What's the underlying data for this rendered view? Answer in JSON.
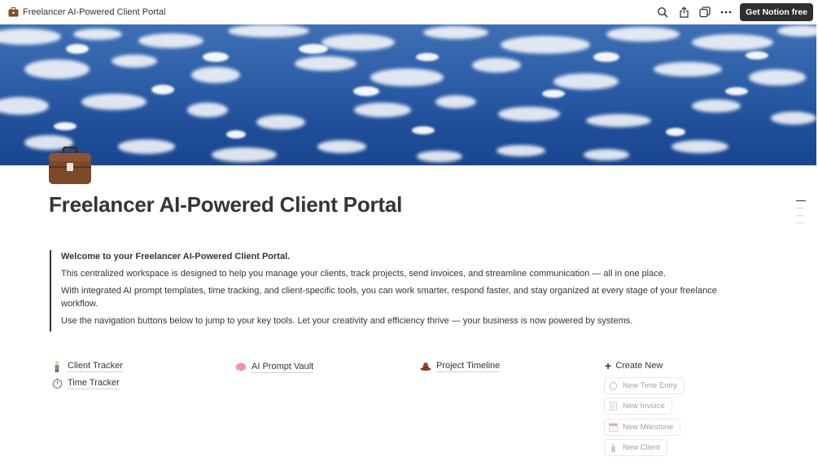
{
  "topbar": {
    "title": "Freelancer AI-Powered Client Portal",
    "icons": [
      "search-icon",
      "share-icon",
      "duplicate-icon",
      "more-icon"
    ],
    "cta_label": "Get Notion free"
  },
  "page": {
    "icon": "briefcase-icon",
    "title": "Freelancer AI-Powered Client Portal"
  },
  "callout": {
    "heading": "Welcome to your Freelancer AI-Powered Client Portal.",
    "p1": "This centralized workspace is designed to help you manage your clients, track projects, send invoices, and streamline communication — all in one place.",
    "p2": "With integrated AI prompt templates, time tracking, and client-specific tools, you can work smarter, respond faster, and stay organized at every stage of your freelance workflow.",
    "p3": "Use the navigation buttons below to jump to your key tools. Let your creativity and efficiency thrive — your business is now powered by systems."
  },
  "nav": {
    "client_tracker": "Client Tracker",
    "time_tracker": "Time Tracker",
    "prompt_vault": "AI Prompt Vault",
    "project_timeline": "Project Timeline"
  },
  "create": {
    "label": "Create New",
    "templates": [
      {
        "label": "New Time Entry",
        "icon": "stopwatch-icon"
      },
      {
        "label": "New Invoice",
        "icon": "receipt-icon"
      },
      {
        "label": "New Milestone",
        "icon": "calendar-icon"
      },
      {
        "label": "New Client",
        "icon": "person-icon"
      }
    ]
  }
}
